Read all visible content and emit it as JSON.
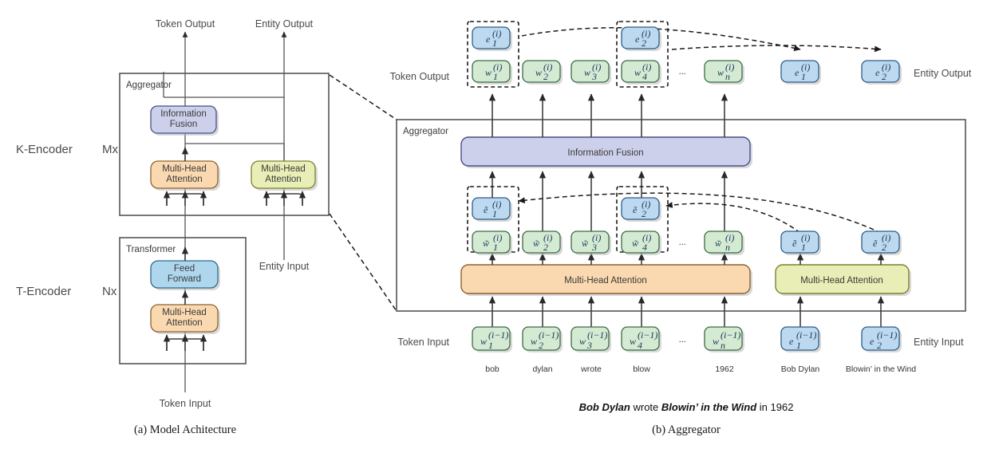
{
  "figure": {
    "panel_a": {
      "caption": "(a) Model Achitecture",
      "encoders": [
        {
          "name": "K-Encoder",
          "repeat": "Mx"
        },
        {
          "name": "T-Encoder",
          "repeat": "Nx"
        }
      ],
      "containers": [
        {
          "label": "Aggregator"
        },
        {
          "label": "Transformer"
        }
      ],
      "blocks": [
        {
          "label_line1": "Information",
          "label_line2": "Fusion",
          "color": "#cdd0ea"
        },
        {
          "label_line1": "Multi-Head",
          "label_line2": "Attention",
          "color": "#fbd9b0"
        },
        {
          "label_line1": "Multi-Head",
          "label_line2": "Attention",
          "color": "#e9eeb6"
        },
        {
          "label_line1": "Feed",
          "label_line2": "Forward",
          "color": "#aed7ee"
        },
        {
          "label_line1": "Multi-Head",
          "label_line2": "Attention",
          "color": "#fbd9b0"
        }
      ],
      "io_labels": {
        "token_output": "Token Output",
        "entity_output": "Entity Output",
        "token_input": "Token Input",
        "entity_input": "Entity Input"
      }
    },
    "panel_b": {
      "caption": "(b) Aggregator",
      "container_label": "Aggregator",
      "fusion_label": "Information Fusion",
      "attention_token_label": "Multi-Head Attention",
      "attention_entity_label": "Multi-Head Attention",
      "row_labels": {
        "token_output": "Token Output",
        "entity_output": "Entity Output",
        "token_input": "Token Input",
        "entity_input": "Entity Input"
      },
      "ellipsis": "···",
      "token_output_nodes": [
        {
          "base": "w",
          "sub": "1",
          "sup": "(i)"
        },
        {
          "base": "w",
          "sub": "2",
          "sup": "(i)"
        },
        {
          "base": "w",
          "sub": "3",
          "sup": "(i)"
        },
        {
          "base": "w",
          "sub": "4",
          "sup": "(i)"
        },
        {
          "base": "w",
          "sub": "n",
          "sup": "(i)"
        }
      ],
      "entity_output_stacked": [
        {
          "base": "e",
          "sub": "1",
          "sup": "(i)"
        },
        {
          "base": "e",
          "sub": "2",
          "sup": "(i)"
        }
      ],
      "entity_output_nodes": [
        {
          "base": "e",
          "sub": "1",
          "sup": "(i)"
        },
        {
          "base": "e",
          "sub": "2",
          "sup": "(i)"
        }
      ],
      "token_hidden_nodes": [
        {
          "base": "w̃",
          "sub": "1",
          "sup": "(i)"
        },
        {
          "base": "w̃",
          "sub": "2",
          "sup": "(i)"
        },
        {
          "base": "w̃",
          "sub": "3",
          "sup": "(i)"
        },
        {
          "base": "w̃",
          "sub": "4",
          "sup": "(i)"
        },
        {
          "base": "w̃",
          "sub": "n",
          "sup": "(i)"
        }
      ],
      "entity_hidden_stacked": [
        {
          "base": "ẽ",
          "sub": "1",
          "sup": "(i)"
        },
        {
          "base": "ẽ",
          "sub": "2",
          "sup": "(i)"
        }
      ],
      "entity_hidden_nodes": [
        {
          "base": "ẽ",
          "sub": "1",
          "sup": "(i)"
        },
        {
          "base": "ẽ",
          "sub": "2",
          "sup": "(i)"
        }
      ],
      "token_input_nodes": [
        {
          "base": "w",
          "sub": "1",
          "sup": "(i−1)",
          "word": "bob"
        },
        {
          "base": "w",
          "sub": "2",
          "sup": "(i−1)",
          "word": "dylan"
        },
        {
          "base": "w",
          "sub": "3",
          "sup": "(i−1)",
          "word": "wrote"
        },
        {
          "base": "w",
          "sub": "4",
          "sup": "(i−1)",
          "word": "blow"
        },
        {
          "base": "w",
          "sub": "n",
          "sup": "(i−1)",
          "word": "1962"
        }
      ],
      "entity_input_nodes": [
        {
          "base": "e",
          "sub": "1",
          "sup": "(i−1)",
          "word": "Bob Dylan"
        },
        {
          "base": "e",
          "sub": "2",
          "sup": "(i−1)",
          "word": "Blowin’ in the Wind"
        }
      ],
      "example_sentence": {
        "part1": "Bob Dylan",
        "part2": " wrote ",
        "part3": "Blowin’ in the Wind",
        "part4": " in 1962"
      }
    },
    "colors": {
      "token_node": "#d5ead2",
      "token_node_border": "#3b6b45",
      "entity_node": "#bdd9ef",
      "entity_node_border": "#2e5c86",
      "fusion": "#cdd0ea",
      "fusion_border": "#4a4e86",
      "attention_token": "#fbd9b0",
      "attention_token_border": "#8a6330",
      "attention_entity": "#e9eeb6",
      "attention_entity_border": "#7c8130",
      "feed_forward": "#aed7ee",
      "feed_forward_border": "#2e6a8e"
    }
  }
}
